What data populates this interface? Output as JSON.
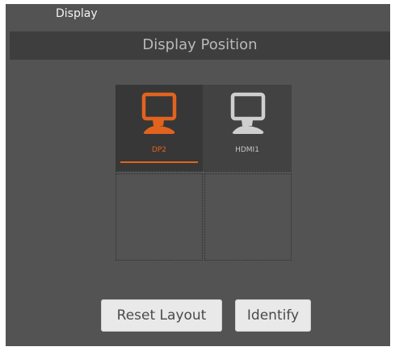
{
  "window": {
    "title": "Display"
  },
  "header": {
    "title": "Display Position"
  },
  "displays": [
    {
      "label": "DP2",
      "selected": true,
      "color": "#e2631e",
      "icon": "monitor-icon"
    },
    {
      "label": "HDMI1",
      "selected": false,
      "color": "#cfcfcf",
      "icon": "monitor-icon"
    }
  ],
  "buttons": {
    "reset_label": "Reset Layout",
    "identify_label": "Identify"
  },
  "colors": {
    "accent": "#e2631e",
    "background": "#535353",
    "header_bar": "#3e3e3e"
  }
}
